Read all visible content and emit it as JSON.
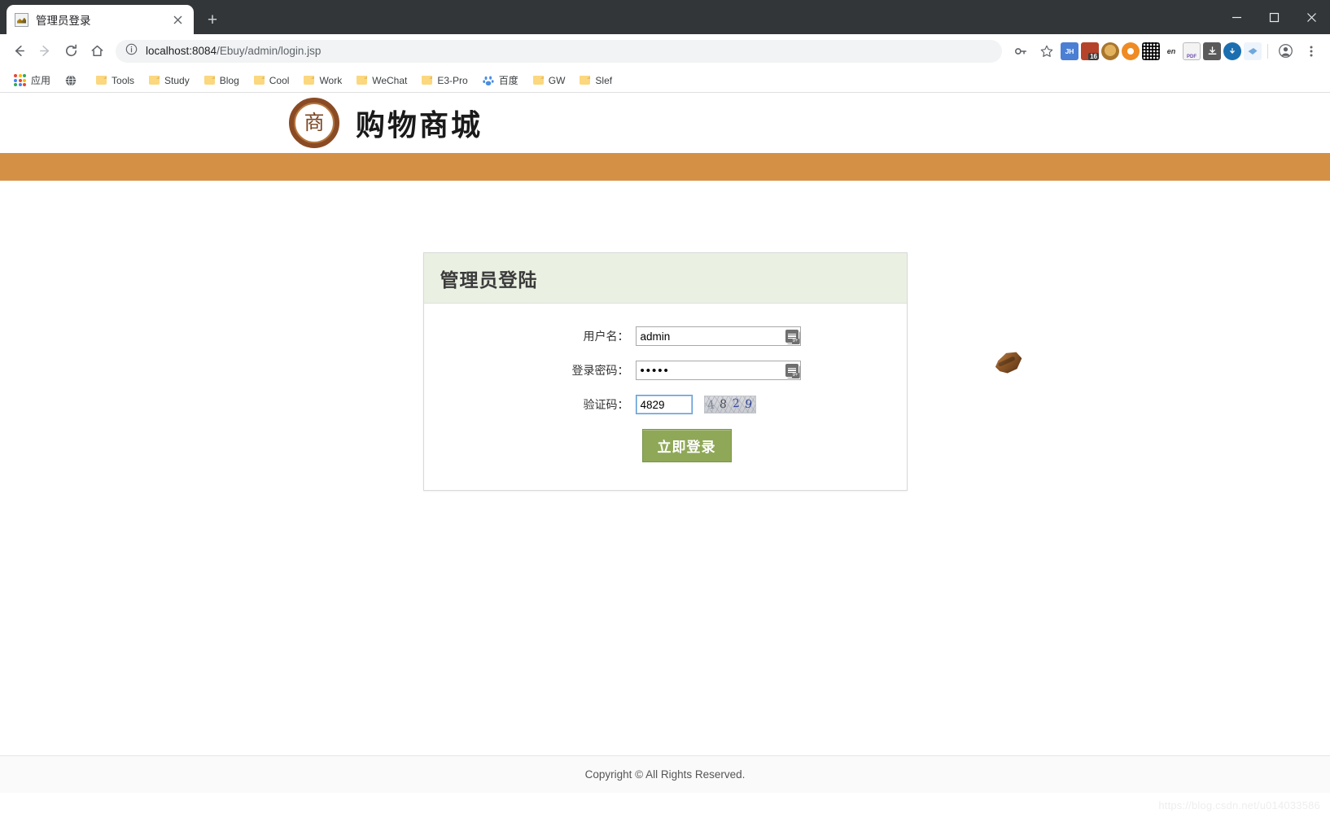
{
  "browser": {
    "tab": {
      "title": "管理员登录",
      "favicon": "page-favicon",
      "close": "✕"
    },
    "new_tab": "+",
    "window_controls": {
      "minimize": "—",
      "maximize": "▢",
      "close": "✕"
    },
    "nav": {
      "back": "←",
      "forward": "→",
      "reload": "⟳",
      "home": "⌂"
    },
    "omnibox": {
      "info_icon": "ⓘ",
      "url_host": "localhost:8084",
      "url_path": "/Ebuy/admin/login.jsp",
      "key_icon": "key-icon",
      "star_icon": "☆"
    },
    "extensions": [
      {
        "name": "jh-extension",
        "label": "JH",
        "color": "#4a7fd4"
      },
      {
        "name": "badge-extension",
        "label": "16",
        "color": "#b5432c"
      },
      {
        "name": "monkey-extension",
        "label": "",
        "color": "#c9a227"
      },
      {
        "name": "orange-extension",
        "label": "",
        "color": "#ef8b22"
      },
      {
        "name": "qrcode-extension",
        "label": "",
        "color": "#2b2b2b"
      },
      {
        "name": "en-translate-extension",
        "label": "en",
        "color": "#ffffff"
      },
      {
        "name": "pdf-extension",
        "label": "PDF",
        "color": "#8a6fc4"
      },
      {
        "name": "download-extension",
        "label": "",
        "color": "#5a5a5a"
      },
      {
        "name": "idm-extension",
        "label": "",
        "color": "#1b6fb0"
      },
      {
        "name": "bird-extension",
        "label": "",
        "color": "#6fa8dc"
      }
    ],
    "profile_icon": "profile-icon",
    "menu_icon": "⋮",
    "bookmarks": [
      {
        "name": "apps",
        "label": "应用",
        "icon": "apps-grid-icon"
      },
      {
        "name": "globe",
        "label": "",
        "icon": "globe-icon"
      },
      {
        "name": "tools",
        "label": "Tools",
        "icon": "folder-icon"
      },
      {
        "name": "study",
        "label": "Study",
        "icon": "folder-icon"
      },
      {
        "name": "blog",
        "label": "Blog",
        "icon": "folder-icon"
      },
      {
        "name": "cool",
        "label": "Cool",
        "icon": "folder-icon"
      },
      {
        "name": "work",
        "label": "Work",
        "icon": "folder-icon"
      },
      {
        "name": "wechat",
        "label": "WeChat",
        "icon": "folder-icon"
      },
      {
        "name": "e3pro",
        "label": "E3-Pro",
        "icon": "folder-icon"
      },
      {
        "name": "baidu",
        "label": "百度",
        "icon": "baidu-paw-icon"
      },
      {
        "name": "gw",
        "label": "GW",
        "icon": "folder-icon"
      },
      {
        "name": "slef",
        "label": "Slef",
        "icon": "folder-icon"
      }
    ]
  },
  "site": {
    "logo_glyph": "商",
    "title": "购物商城",
    "navbar_color": "#d49146"
  },
  "login": {
    "panel_title": "管理员登陆",
    "fields": [
      {
        "label": "用户名：",
        "value": "admin",
        "placeholder": "",
        "type": "text"
      },
      {
        "label": "登录密码：",
        "value": "•••••",
        "placeholder": "",
        "type": "password"
      },
      {
        "label": "验证码：",
        "value": "4829",
        "placeholder": "",
        "type": "text"
      }
    ],
    "captcha_text": "4829",
    "captcha_digits": [
      "4",
      "8",
      "2",
      "9"
    ],
    "submit_label": "立即登录",
    "submit_color": "#8fa858",
    "header_bg": "#eaf1e3"
  },
  "footer": {
    "text": "Copyright © All Rights Reserved."
  },
  "watermark": {
    "text": "https://blog.csdn.net/u014033586"
  }
}
